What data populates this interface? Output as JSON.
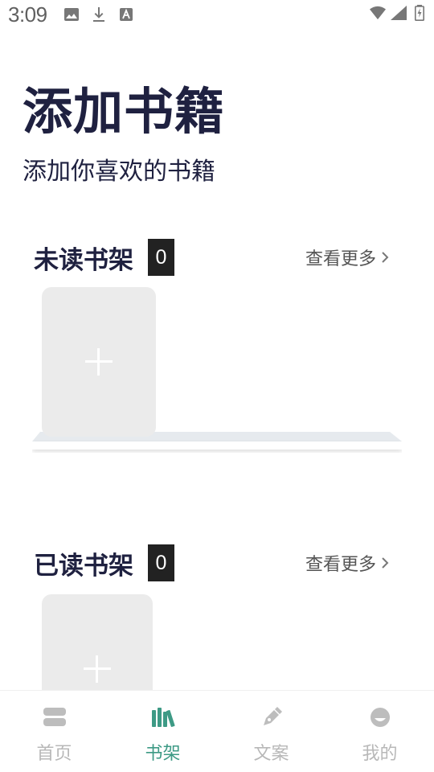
{
  "status_bar": {
    "time": "3:09",
    "left_icons": [
      "image-icon",
      "download-icon",
      "a-box-icon"
    ],
    "right_icons": [
      "wifi-icon",
      "signal-icon",
      "battery-icon"
    ]
  },
  "header": {
    "title": "添加书籍",
    "subtitle": "添加你喜欢的书籍"
  },
  "unread_shelf": {
    "title": "未读书架",
    "count": "0",
    "view_more": "查看更多"
  },
  "read_shelf": {
    "title": "已读书架",
    "count": "0",
    "view_more": "查看更多"
  },
  "bottom_nav": {
    "items": [
      {
        "label": "首页",
        "icon": "home-icon"
      },
      {
        "label": "书架",
        "icon": "bookshelf-icon"
      },
      {
        "label": "文案",
        "icon": "pen-icon"
      },
      {
        "label": "我的",
        "icon": "profile-icon"
      }
    ],
    "active_index": 1
  },
  "colors": {
    "title": "#1f2140",
    "badge": "#222222",
    "card": "#ebebeb",
    "accent": "#3d9a85",
    "inactive": "#b8b8b8"
  }
}
